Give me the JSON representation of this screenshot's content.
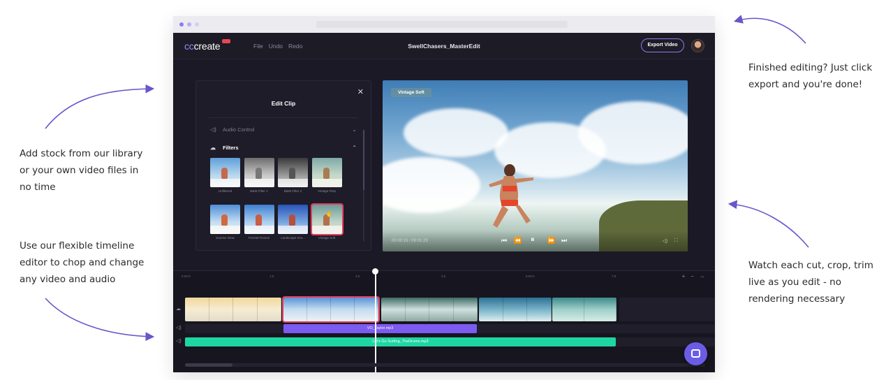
{
  "annotations": {
    "left_top": "Add stock from our library or your own video files in no time",
    "left_bottom": "Use our flexible timeline editor to chop and change any video and audio",
    "right_top": "Finished editing? Just click export and you're done!",
    "right_bottom": "Watch each cut, crop, trim live as you edit - no rendering necessary"
  },
  "colors": {
    "accent_purple": "#6b5ce7",
    "selection_red": "#e83d5e",
    "arrow_purple": "#6a55c9",
    "audio_purple": "#7b5bf0",
    "audio_green": "#1ed6a4"
  },
  "app": {
    "logo_cc": "cc",
    "logo_rest": "create",
    "menu": [
      "File",
      "Undo",
      "Redo"
    ],
    "project_title": "SwellChasers_MasterEdit",
    "export_label": "Export Video",
    "avatar_icon": "user-avatar"
  },
  "edit_panel": {
    "title": "Edit Clip",
    "close_icon": "close-icon",
    "audio_section": "Audio Control",
    "filters_section": "Filters",
    "filters": [
      {
        "name": "Unfiltered",
        "selected": false
      },
      {
        "name": "B&W Filter 1",
        "selected": false
      },
      {
        "name": "B&W Filter 2",
        "selected": false
      },
      {
        "name": "Vintage Prep",
        "selected": false
      },
      {
        "name": "Sunrise Glow",
        "selected": false
      },
      {
        "name": "Portrait Fixtone",
        "selected": false
      },
      {
        "name": "Landscape Gra...",
        "selected": false
      },
      {
        "name": "Vintage Soft",
        "selected": true
      }
    ]
  },
  "preview": {
    "filter_label": "Vintage Soft",
    "timecode": "00:00:15 / 00:01:23"
  },
  "timeline": {
    "ruler": [
      "0:00:0",
      "1:5",
      "3:0",
      "4:5",
      "6:00:0",
      "7:5"
    ],
    "audio_track_1": "VO_Taylor.mp3",
    "audio_track_2": "Let's Go Surfing_TheDrums.mp3"
  }
}
